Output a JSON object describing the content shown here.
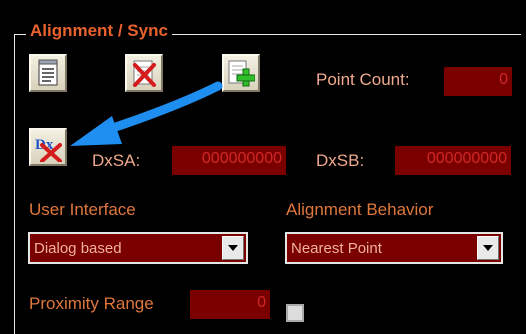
{
  "group": {
    "title": "Alignment / Sync"
  },
  "toolbar": {
    "notes_icon": "notepad-icon",
    "delete_icon": "delete-points-icon",
    "add_icon": "add-point-icon",
    "dx_icon": "delete-dx-icon",
    "dx_icon_text": "Dx"
  },
  "point_count": {
    "label": "Point Count:",
    "value": "0"
  },
  "dxsa": {
    "label": "DxSA:",
    "value": "000000000"
  },
  "dxsb": {
    "label": "DxSB:",
    "value": "000000000"
  },
  "user_interface": {
    "label": "User Interface",
    "selected": "Dialog based"
  },
  "alignment_behavior": {
    "label": "Alignment Behavior",
    "selected": "Nearest Point"
  },
  "proximity_range": {
    "label": "Proximity Range",
    "value": "0"
  },
  "colors": {
    "accent": "#e7622c",
    "field_bg": "#7a0000",
    "field_text": "#d12626",
    "arrow": "#1e8ef0"
  }
}
